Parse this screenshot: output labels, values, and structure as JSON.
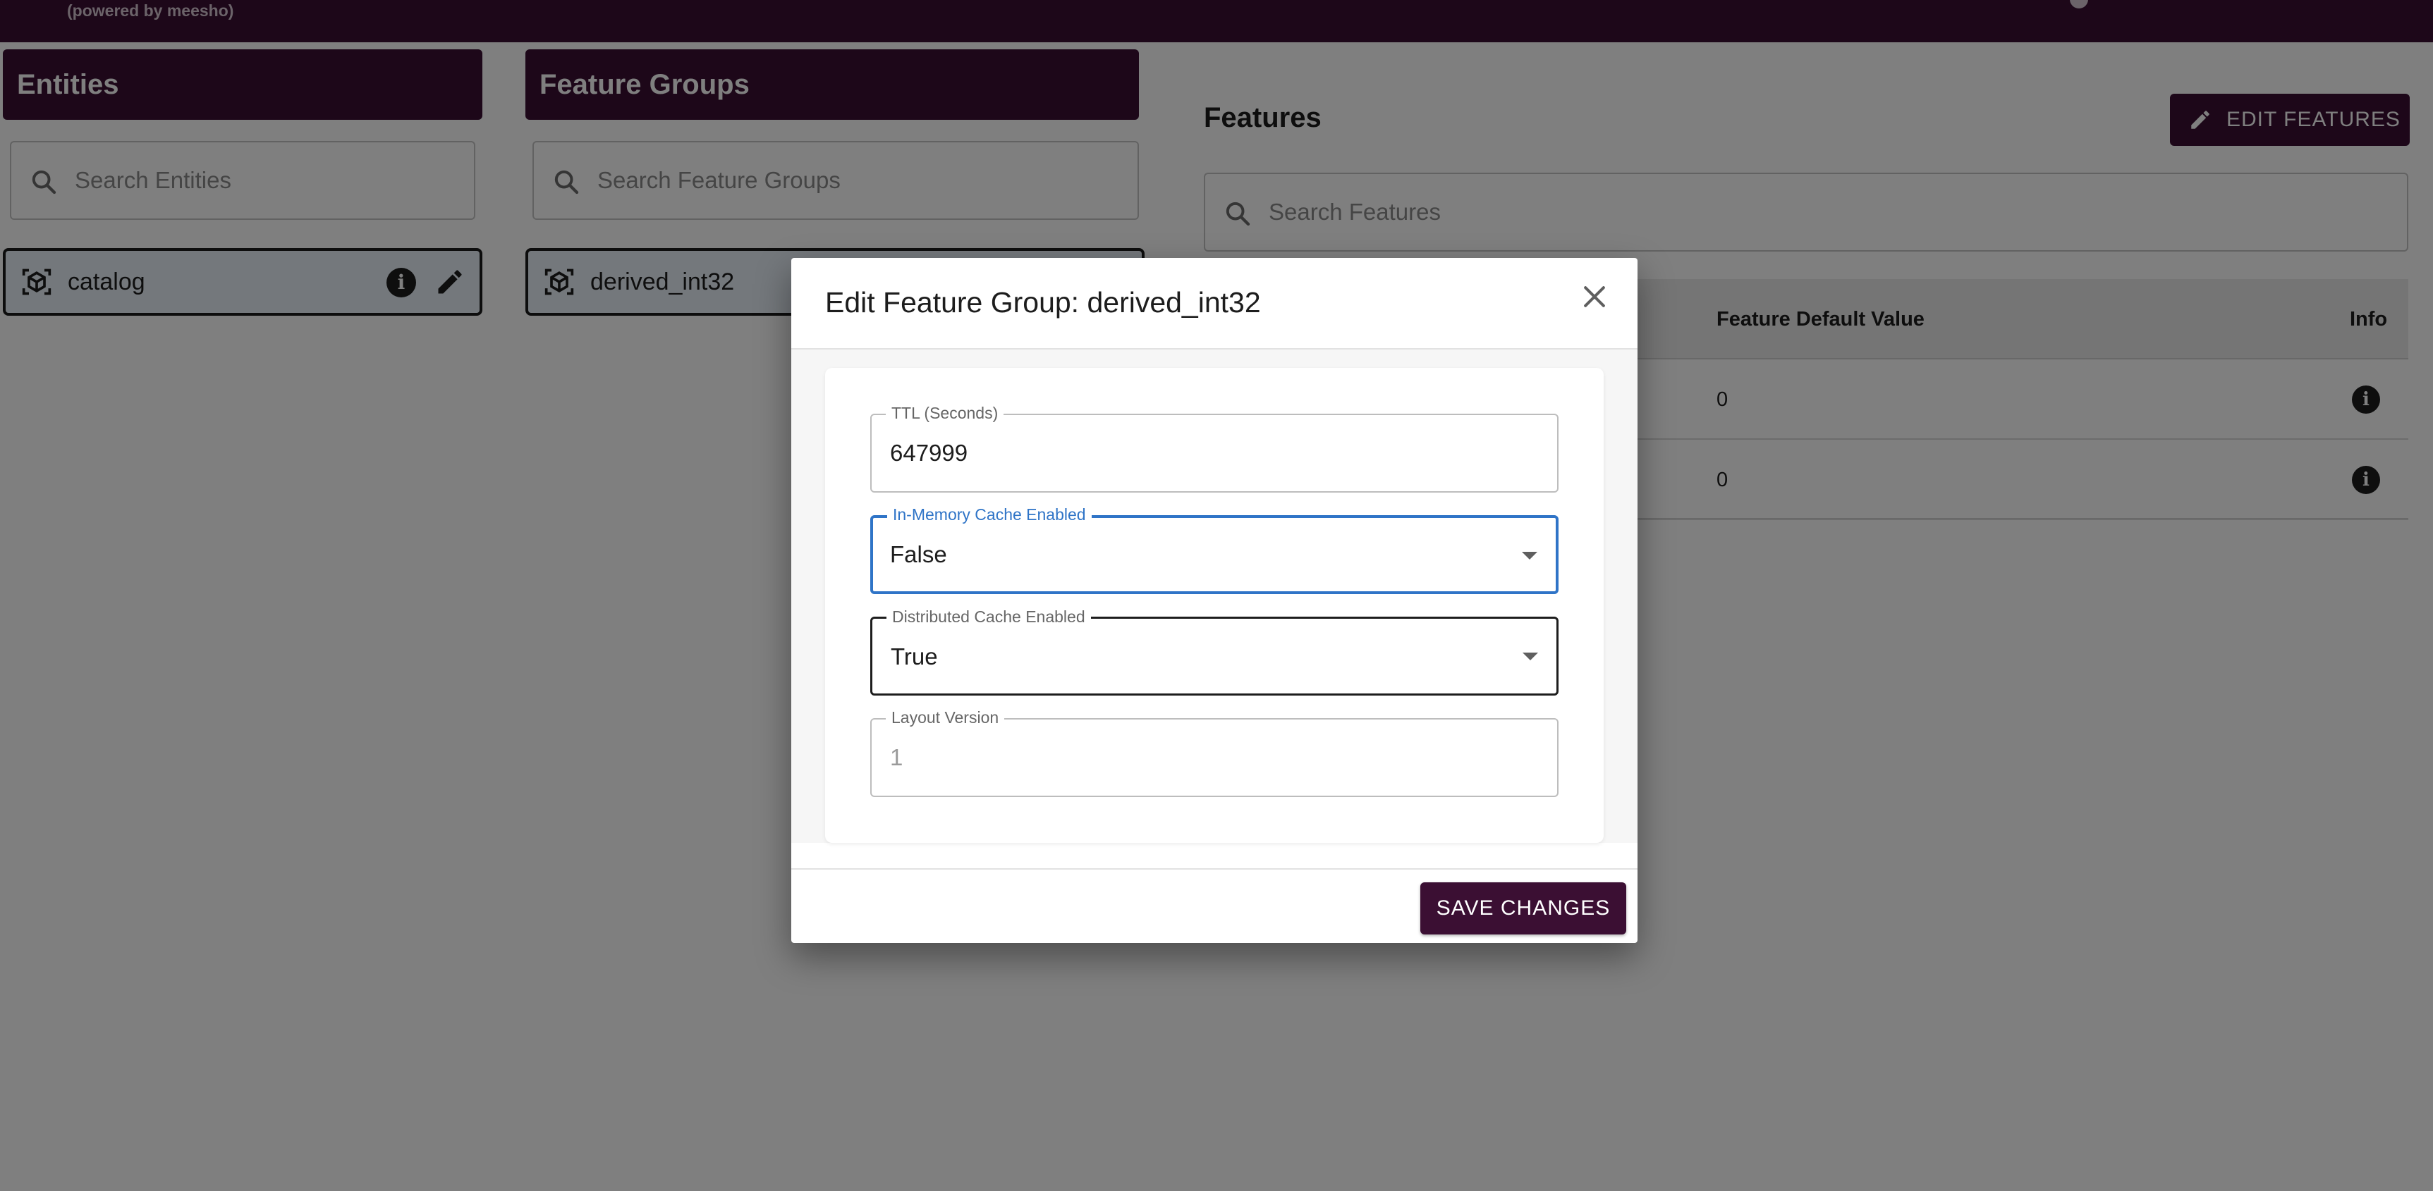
{
  "app": {
    "powered_by": "(powered by meesho)"
  },
  "entities": {
    "header": "Entities",
    "search_placeholder": "Search Entities",
    "items": [
      {
        "label": "catalog",
        "icon": "cube-scan-icon"
      }
    ]
  },
  "feature_groups": {
    "header": "Feature Groups",
    "search_placeholder": "Search Feature Groups",
    "items": [
      {
        "label": "derived_int32",
        "icon": "cube-scan-icon"
      }
    ]
  },
  "features": {
    "title": "Features",
    "edit_button": "EDIT FEATURES",
    "search_placeholder": "Search Features",
    "columns": {
      "default_value": "Feature Default Value",
      "info": "Info"
    },
    "rows": [
      {
        "default_value": "0"
      },
      {
        "default_value": "0"
      }
    ]
  },
  "modal": {
    "title": "Edit Feature Group: derived_int32",
    "fields": {
      "ttl": {
        "label": "TTL (Seconds)",
        "value": "647999"
      },
      "in_memory_cache": {
        "label": "In-Memory Cache Enabled",
        "value": "False"
      },
      "distributed_cache": {
        "label": "Distributed Cache Enabled",
        "value": "True"
      },
      "layout_version": {
        "label": "Layout Version",
        "value": "1"
      }
    },
    "save_button": "SAVE CHANGES"
  },
  "colors": {
    "brand": "#3b0f33",
    "focus": "#2f74c7"
  }
}
